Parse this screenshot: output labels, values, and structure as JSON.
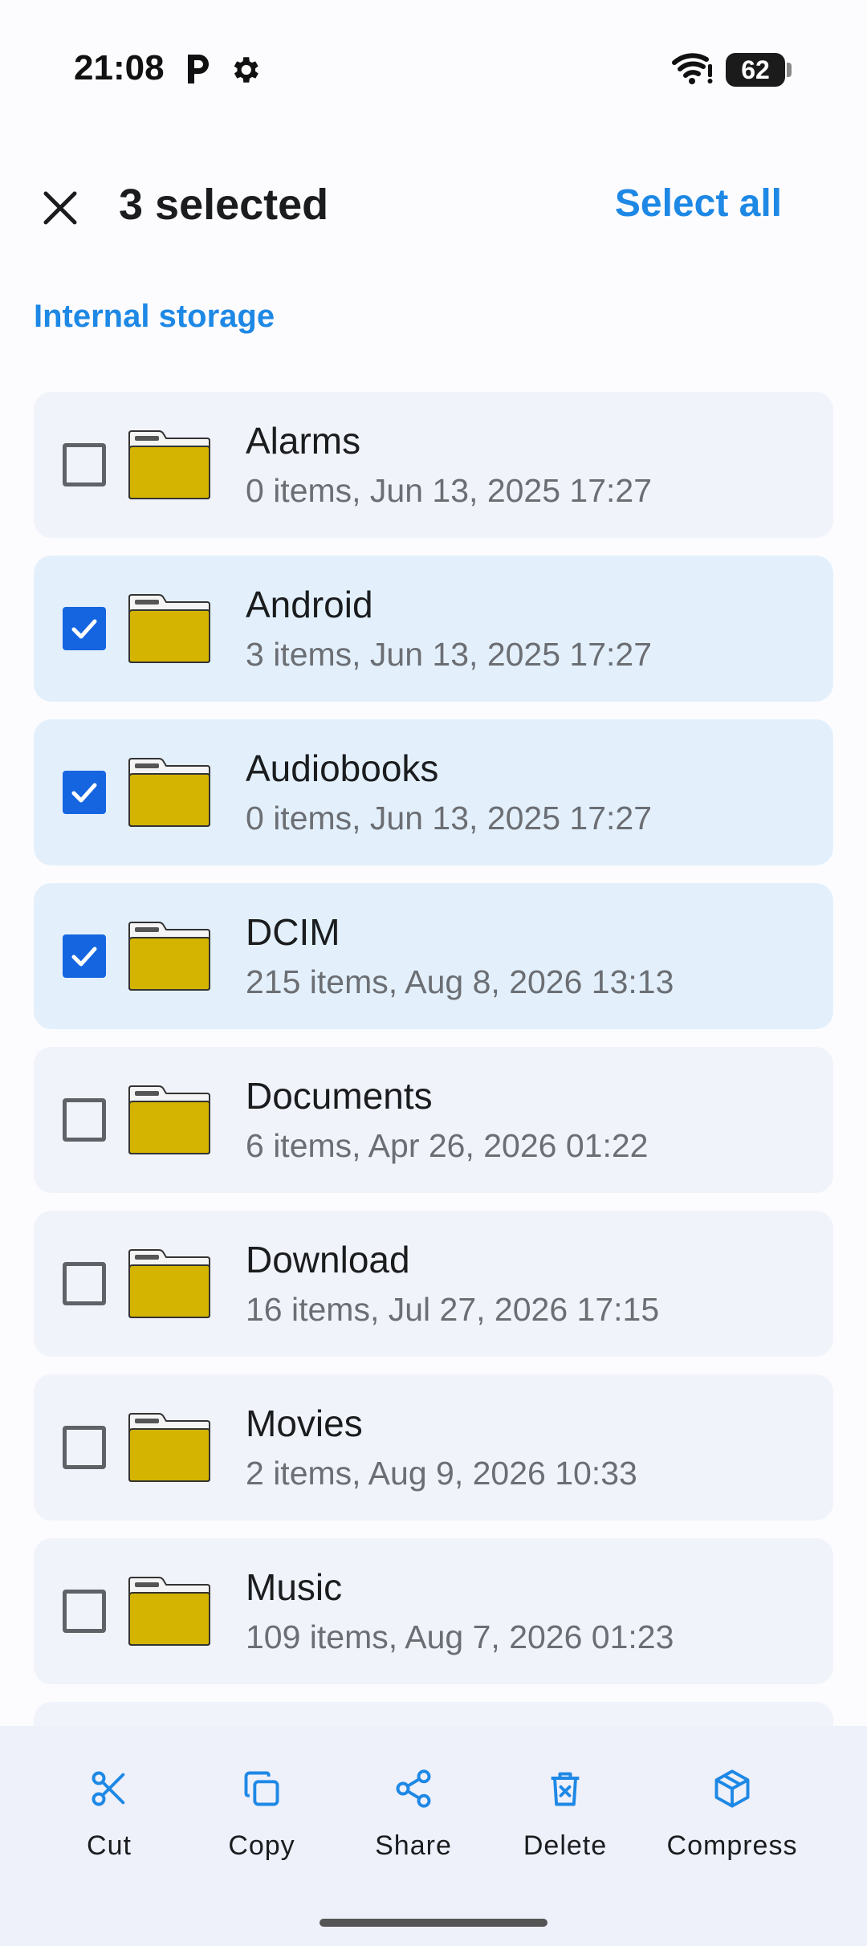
{
  "status_bar": {
    "time": "21:08",
    "icons": [
      "parking-icon",
      "gear-icon",
      "wifi-icon"
    ],
    "battery_level": "62"
  },
  "app_bar": {
    "title": "3 selected",
    "select_all_label": "Select all",
    "close_icon": "close-icon"
  },
  "breadcrumb": "Internal storage",
  "files": [
    {
      "name": "Alarms",
      "meta": "0 items, Jun 13, 2025 17:27",
      "checked": false
    },
    {
      "name": "Android",
      "meta": "3 items, Jun 13, 2025 17:27",
      "checked": true
    },
    {
      "name": "Audiobooks",
      "meta": "0 items, Jun 13, 2025 17:27",
      "checked": true
    },
    {
      "name": "DCIM",
      "meta": "215 items, Aug 8, 2026 13:13",
      "checked": true
    },
    {
      "name": "Documents",
      "meta": "6 items, Apr 26, 2026 01:22",
      "checked": false
    },
    {
      "name": "Download",
      "meta": "16 items, Jul 27, 2026 17:15",
      "checked": false
    },
    {
      "name": "Movies",
      "meta": "2 items, Aug 9, 2026 10:33",
      "checked": false
    },
    {
      "name": "Music",
      "meta": "109 items, Aug 7, 2026 01:23",
      "checked": false
    }
  ],
  "actions": [
    {
      "label": "Cut",
      "icon": "scissors-icon"
    },
    {
      "label": "Copy",
      "icon": "copy-icon"
    },
    {
      "label": "Share",
      "icon": "share-icon"
    },
    {
      "label": "Delete",
      "icon": "delete-icon"
    },
    {
      "label": "Compress",
      "icon": "package-icon"
    }
  ],
  "colors": {
    "accent": "#1E88E5",
    "checkbox_checked": "#1565E0",
    "row_bg": "#F1F3FB",
    "row_selected_bg": "#E3F0FC",
    "folder": "#D4B400"
  }
}
